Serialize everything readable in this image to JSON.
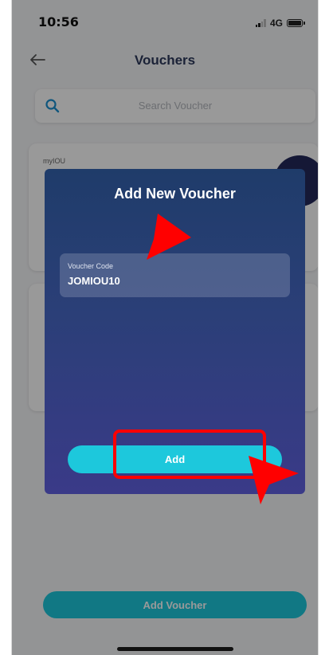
{
  "status_bar": {
    "time": "10:56",
    "network": "4G"
  },
  "header": {
    "title": "Vouchers",
    "back_icon": "arrow-left-icon"
  },
  "search": {
    "placeholder": "Search Voucher",
    "icon": "search-icon"
  },
  "cards": [
    {
      "brand": "myIOU"
    }
  ],
  "bottom": {
    "button_label": "Add Voucher"
  },
  "modal": {
    "title": "Add New Voucher",
    "code_label": "Voucher Code",
    "code_value": "JOMIOU10",
    "add_label": "Add"
  },
  "colors": {
    "accent": "#1dc8dc",
    "modal_top": "#1f3c6a",
    "modal_bottom": "#3a3a88",
    "annotation": "#ff0000"
  }
}
